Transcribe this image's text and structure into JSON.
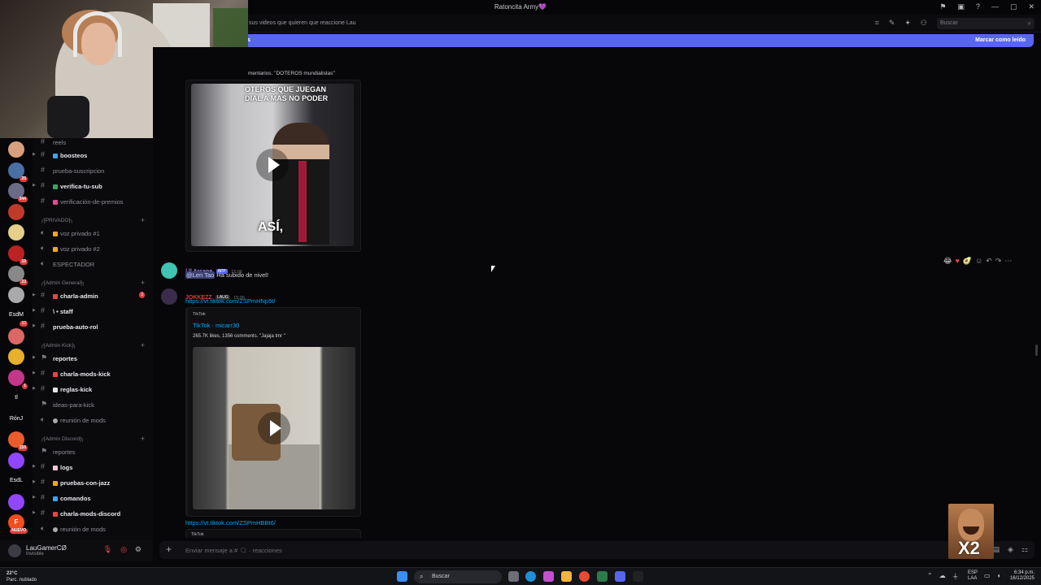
{
  "window": {
    "title": "Ratoncita Army💜"
  },
  "topbar": {
    "topic": "sus videos que quieren que reaccione Lau",
    "search_placeholder": "Buscar"
  },
  "banner": {
    "left_text": "s",
    "mark_read": "Marcar como leído"
  },
  "servers": [
    {
      "label": "",
      "color": "#d9a07f",
      "badge": ""
    },
    {
      "label": "",
      "color": "#4a6fa5",
      "badge": "25"
    },
    {
      "label": "",
      "color": "#6b6b88",
      "badge": "344"
    },
    {
      "label": "",
      "color": "#c03a2b",
      "badge": ""
    },
    {
      "label": "",
      "color": "#e6d089",
      "badge": ""
    },
    {
      "label": "",
      "color": "#b22",
      "badge": "19"
    },
    {
      "label": "",
      "color": "#888",
      "badge": "23"
    },
    {
      "label": "",
      "color": "#aaa",
      "badge": ""
    },
    {
      "label": "EsdM",
      "color": "",
      "badge": "10"
    },
    {
      "label": "",
      "color": "#d66",
      "badge": ""
    },
    {
      "label": "",
      "color": "#e8b12c",
      "badge": ""
    },
    {
      "label": "",
      "color": "#c2378a",
      "badge": "1"
    },
    {
      "label": "tl",
      "color": "",
      "badge": ""
    },
    {
      "label": "RónJ",
      "color": "",
      "badge": ""
    },
    {
      "label": "",
      "color": "#e85d2b",
      "badge": "159"
    },
    {
      "label": "",
      "color": "#9146ff",
      "badge": ""
    },
    {
      "label": "EsdL",
      "color": "",
      "badge": ""
    },
    {
      "label": "",
      "color": "#9146ff",
      "badge": ""
    },
    {
      "label": "F",
      "color": "#f24e1e",
      "badge": "NUEVO"
    }
  ],
  "channels": {
    "top_partial": "reels",
    "items": [
      {
        "name": "boosteos",
        "bold": true,
        "dot": "#3ba5ff",
        "type": "text"
      },
      {
        "name": "prueba-suscripcion",
        "bold": false,
        "dot": "",
        "type": "text"
      },
      {
        "name": "verifica-tu-sub",
        "bold": true,
        "dot": "#3ba55d",
        "type": "text"
      },
      {
        "name": "verificación-de-premios",
        "bold": false,
        "dot": "#eb459e",
        "type": "text"
      }
    ],
    "cat_privado": "╭[PRIVADO]╮",
    "privado_items": [
      {
        "name": "voz privado #1",
        "dot": "#faa61a"
      },
      {
        "name": "voz privado #2",
        "dot": "#faa61a"
      },
      {
        "name": "ESPECTADOR",
        "dot": ""
      }
    ],
    "cat_admin_general": "╭[Admin General]╮",
    "admin_general_items": [
      {
        "name": "charla-admin",
        "bold": true,
        "dot": "#ed4245",
        "badge": "3"
      },
      {
        "name": "\\ • staff",
        "bold": true,
        "dot": "",
        "badge": ""
      },
      {
        "name": "prueba-auto-rol",
        "bold": true,
        "dot": "",
        "badge": ""
      }
    ],
    "cat_admin_kick": "╭[Admin Kick]╮",
    "admin_kick_items": [
      {
        "name": "reportes",
        "bold": true,
        "dot": ""
      },
      {
        "name": "charla-mods-kick",
        "bold": true,
        "dot": "#ed4245"
      },
      {
        "name": "reglas-kick",
        "bold": true,
        "dot": "#e3e4e8"
      },
      {
        "name": "ideas-para-kick",
        "bold": false,
        "dot": ""
      },
      {
        "name": "reunión de mods",
        "bold": false,
        "dot": "#aaa"
      }
    ],
    "cat_admin_discord": "╭[Admin Discord]╮",
    "admin_discord_items": [
      {
        "name": "reportes",
        "bold": false,
        "dot": ""
      },
      {
        "name": "logs",
        "bold": true,
        "dot": "#f9c8d8"
      },
      {
        "name": "pruebas-con-jazz",
        "bold": true,
        "dot": "#faa61a"
      },
      {
        "name": "comandos",
        "bold": true,
        "dot": "#3ba5ff"
      },
      {
        "name": "charla-mods-discord",
        "bold": true,
        "dot": "#ed4245"
      },
      {
        "name": "reunión de mods",
        "bold": false,
        "dot": "#aaa"
      }
    ]
  },
  "user": {
    "name": "LauGamerCØ",
    "status": "Invisible"
  },
  "messages": {
    "embed1_desc": "mentarios. \"DOTEROS mundialistas\"",
    "video1_caption_top": "OTEROS QUE JUEGAN DIAL A MAS NO PODER",
    "video1_caption_bottom": "ASÍ,",
    "msg2_author": "/ || Arcane",
    "msg2_tag": "APP",
    "msg2_time": "15:06",
    "msg2_mention": "@Len Tao",
    "msg2_text": "Ha subido de nivel!",
    "msg3_author": "JOKKEZZ",
    "msg3_tag": "LAUG",
    "msg3_time": "15:06",
    "msg3_link": "https://vt.tiktok.com/ZSPmHNp5t/",
    "embed2_provider": "TikTok",
    "embed2_title": "TikTok · micarr30",
    "embed2_desc": "265.7K likes, 1356 comments. \"Jajaja tmr \"",
    "msg4_link": "https://vt.tiktok.com/ZSPmHBBt6/",
    "embed3_provider": "TikTok"
  },
  "composer": {
    "placeholder": "Enviar mensaje a # 🗨 · reacciones"
  },
  "taskbar": {
    "temp": "22°C",
    "weather": "Parc. nublado",
    "search": "Buscar",
    "lang1": "ESP",
    "lang2": "LAA",
    "time": "6:34 p.m.",
    "date": "16/12/2025"
  },
  "colors": {
    "accent": "#5865f2",
    "link": "#00a8fc",
    "arcane": "#9b84ec",
    "jokkezz": "#d83c3e"
  }
}
